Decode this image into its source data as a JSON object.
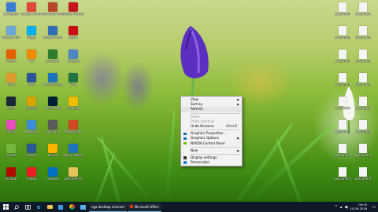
{
  "desktop_icons_left": [
    {
      "label": "Computer",
      "color": "#3a7bd5"
    },
    {
      "label": "Google Chrome",
      "color": "#e0463b"
    },
    {
      "label": "Microsoft Office",
      "color": "#b7472a"
    },
    {
      "label": "Adobe Reader",
      "color": "#c4161c"
    },
    {
      "label": "Recycle Bin",
      "color": "#6aa6d6"
    },
    {
      "label": "Skype",
      "color": "#00aff0"
    },
    {
      "label": "Control Panel",
      "color": "#2f6db5"
    },
    {
      "label": "Opera",
      "color": "#cc0f16"
    },
    {
      "label": "Firefox",
      "color": "#e66000"
    },
    {
      "label": "VLC",
      "color": "#f08a00"
    },
    {
      "label": "Camtasia",
      "color": "#2d7d2d"
    },
    {
      "label": "Notepad",
      "color": "#4f86c6"
    },
    {
      "label": "Paint",
      "color": "#e09a2e"
    },
    {
      "label": "Word",
      "color": "#2b579a"
    },
    {
      "label": "Media Player",
      "color": "#1e73be"
    },
    {
      "label": "Excel",
      "color": "#217346"
    },
    {
      "label": "Steam",
      "color": "#1b2838"
    },
    {
      "label": "Winamp",
      "color": "#d9a400"
    },
    {
      "label": "Photoshop",
      "color": "#001e36"
    },
    {
      "label": "Audacity",
      "color": "#f0c000"
    },
    {
      "label": "iTunes",
      "color": "#ea4cc0"
    },
    {
      "label": "Network",
      "color": "#3c8dde"
    },
    {
      "label": "Calculator",
      "color": "#5a5a5a"
    },
    {
      "label": "PowerPoint",
      "color": "#d24726"
    },
    {
      "label": "Torrent",
      "color": "#76b83f"
    },
    {
      "label": "Games",
      "color": "#2b5797"
    },
    {
      "label": "Picasa",
      "color": "#ffb300"
    },
    {
      "label": "Movie Maker",
      "color": "#1c75bc"
    },
    {
      "label": "Acrobat",
      "color": "#b30b00"
    },
    {
      "label": "Adobe",
      "color": "#ee1c25"
    },
    {
      "label": "Outlook",
      "color": "#0072c6"
    },
    {
      "label": "Documents",
      "color": "#e8c25a"
    }
  ],
  "desktop_icons_right": [
    {
      "label": "Document",
      "color": "#f4f4f4"
    },
    {
      "label": "Document",
      "color": "#f4f4f4"
    },
    {
      "label": "Document",
      "color": "#f4f4f4"
    },
    {
      "label": "Document",
      "color": "#f4f4f4"
    },
    {
      "label": "Document",
      "color": "#f4f4f4"
    },
    {
      "label": "Document",
      "color": "#f4f4f4"
    },
    {
      "label": "Document",
      "color": "#f4f4f4"
    },
    {
      "label": "Document",
      "color": "#f4f4f4"
    },
    {
      "label": "Document",
      "color": "#f4f4f4"
    },
    {
      "label": "Document",
      "color": "#f4f4f4"
    },
    {
      "label": "Document",
      "color": "#f4f4f4"
    },
    {
      "label": "Document",
      "color": "#f4f4f4"
    },
    {
      "label": "Document",
      "color": "#f4f4f4"
    },
    {
      "label": "Document",
      "color": "#f4f4f4"
    },
    {
      "label": "Document",
      "color": "#f4f4f4"
    },
    {
      "label": "Document",
      "color": "#f4f4f4"
    }
  ],
  "context_menu": {
    "view": "View",
    "sort_by": "Sort by",
    "refresh": "Refresh",
    "paste": "Paste",
    "paste_shortcut": "Paste shortcut",
    "undo_rename": "Undo Rename",
    "undo_shortcut": "Ctrl+Z",
    "graphics_properties": "Graphics Properties...",
    "graphics_options": "Graphics Options",
    "nvidia_control_panel": "NVIDIA Control Panel",
    "new": "New",
    "display_settings": "Display settings",
    "personalize": "Personalize"
  },
  "taskbar": {
    "apps": [
      {
        "label": "vga desktop channel"
      },
      {
        "label": "Microsoft Office"
      }
    ],
    "clock_time": "09:00",
    "clock_date": "10-09-2016",
    "accent": "#76b9ed"
  }
}
